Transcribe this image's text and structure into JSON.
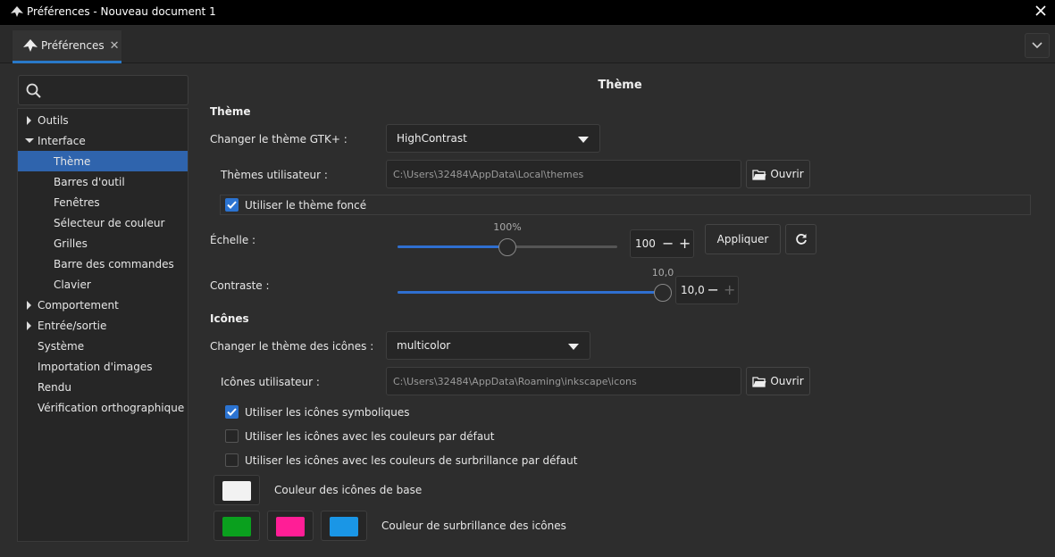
{
  "window": {
    "title": "Préférences - Nouveau document 1"
  },
  "tab": {
    "label": "Préférences"
  },
  "tree": [
    {
      "label": "Outils",
      "expander": "collapsed"
    },
    {
      "label": "Interface",
      "expander": "expanded"
    },
    {
      "label": "Thème",
      "selected": true,
      "child": true
    },
    {
      "label": "Barres d'outil",
      "child": true
    },
    {
      "label": "Fenêtres",
      "child": true
    },
    {
      "label": "Sélecteur de couleur",
      "child": true
    },
    {
      "label": "Grilles",
      "child": true
    },
    {
      "label": "Barre des commandes",
      "child": true
    },
    {
      "label": "Clavier",
      "child": true
    },
    {
      "label": "Comportement",
      "expander": "collapsed"
    },
    {
      "label": "Entrée/sortie",
      "expander": "collapsed"
    },
    {
      "label": "Système"
    },
    {
      "label": "Importation d'images"
    },
    {
      "label": "Rendu"
    },
    {
      "label": "Vérification orthographique"
    }
  ],
  "panel": {
    "title": "Thème",
    "theme_section": "Thème",
    "gtk_label": "Changer le thème GTK+ :",
    "gtk_value": "HighContrast",
    "user_themes_label": "Thèmes utilisateur :",
    "user_themes_path": "C:\\Users\\32484\\AppData\\Local\\themes",
    "open_label": "Ouvrir",
    "dark_theme_label": "Utiliser le thème foncé",
    "dark_theme_checked": true,
    "scale_label": "Échelle :",
    "scale_slider_text": "100%",
    "scale_value": "100",
    "scale_fraction": 0.5,
    "apply_label": "Appliquer",
    "contrast_label": "Contraste :",
    "contrast_slider_text": "10,0",
    "contrast_value": "10,0",
    "contrast_fraction": 1.0,
    "icons_section": "Icônes",
    "icon_theme_label": "Changer le thème des icônes :",
    "icon_theme_value": "multicolor",
    "user_icons_label": "Icônes utilisateur :",
    "user_icons_path": "C:\\Users\\32484\\AppData\\Roaming\\inkscape\\icons",
    "symbolic_label": "Utiliser les icônes symboliques",
    "symbolic_checked": true,
    "default_colors_label": "Utiliser les icônes avec les couleurs par défaut",
    "default_colors_checked": false,
    "default_highlight_label": "Utiliser les icônes avec les couleurs de surbrillance par défaut",
    "default_highlight_checked": false,
    "base_color_label": "Couleur des icônes de base",
    "highlight_color_label": "Couleur de surbrillance des icônes"
  },
  "colors": {
    "accent": "#2f64ad",
    "base_icon": "#f2f2f2",
    "highlight_1": "#0aa01e",
    "highlight_2": "#ff1e96",
    "highlight_3": "#1a96e6"
  }
}
